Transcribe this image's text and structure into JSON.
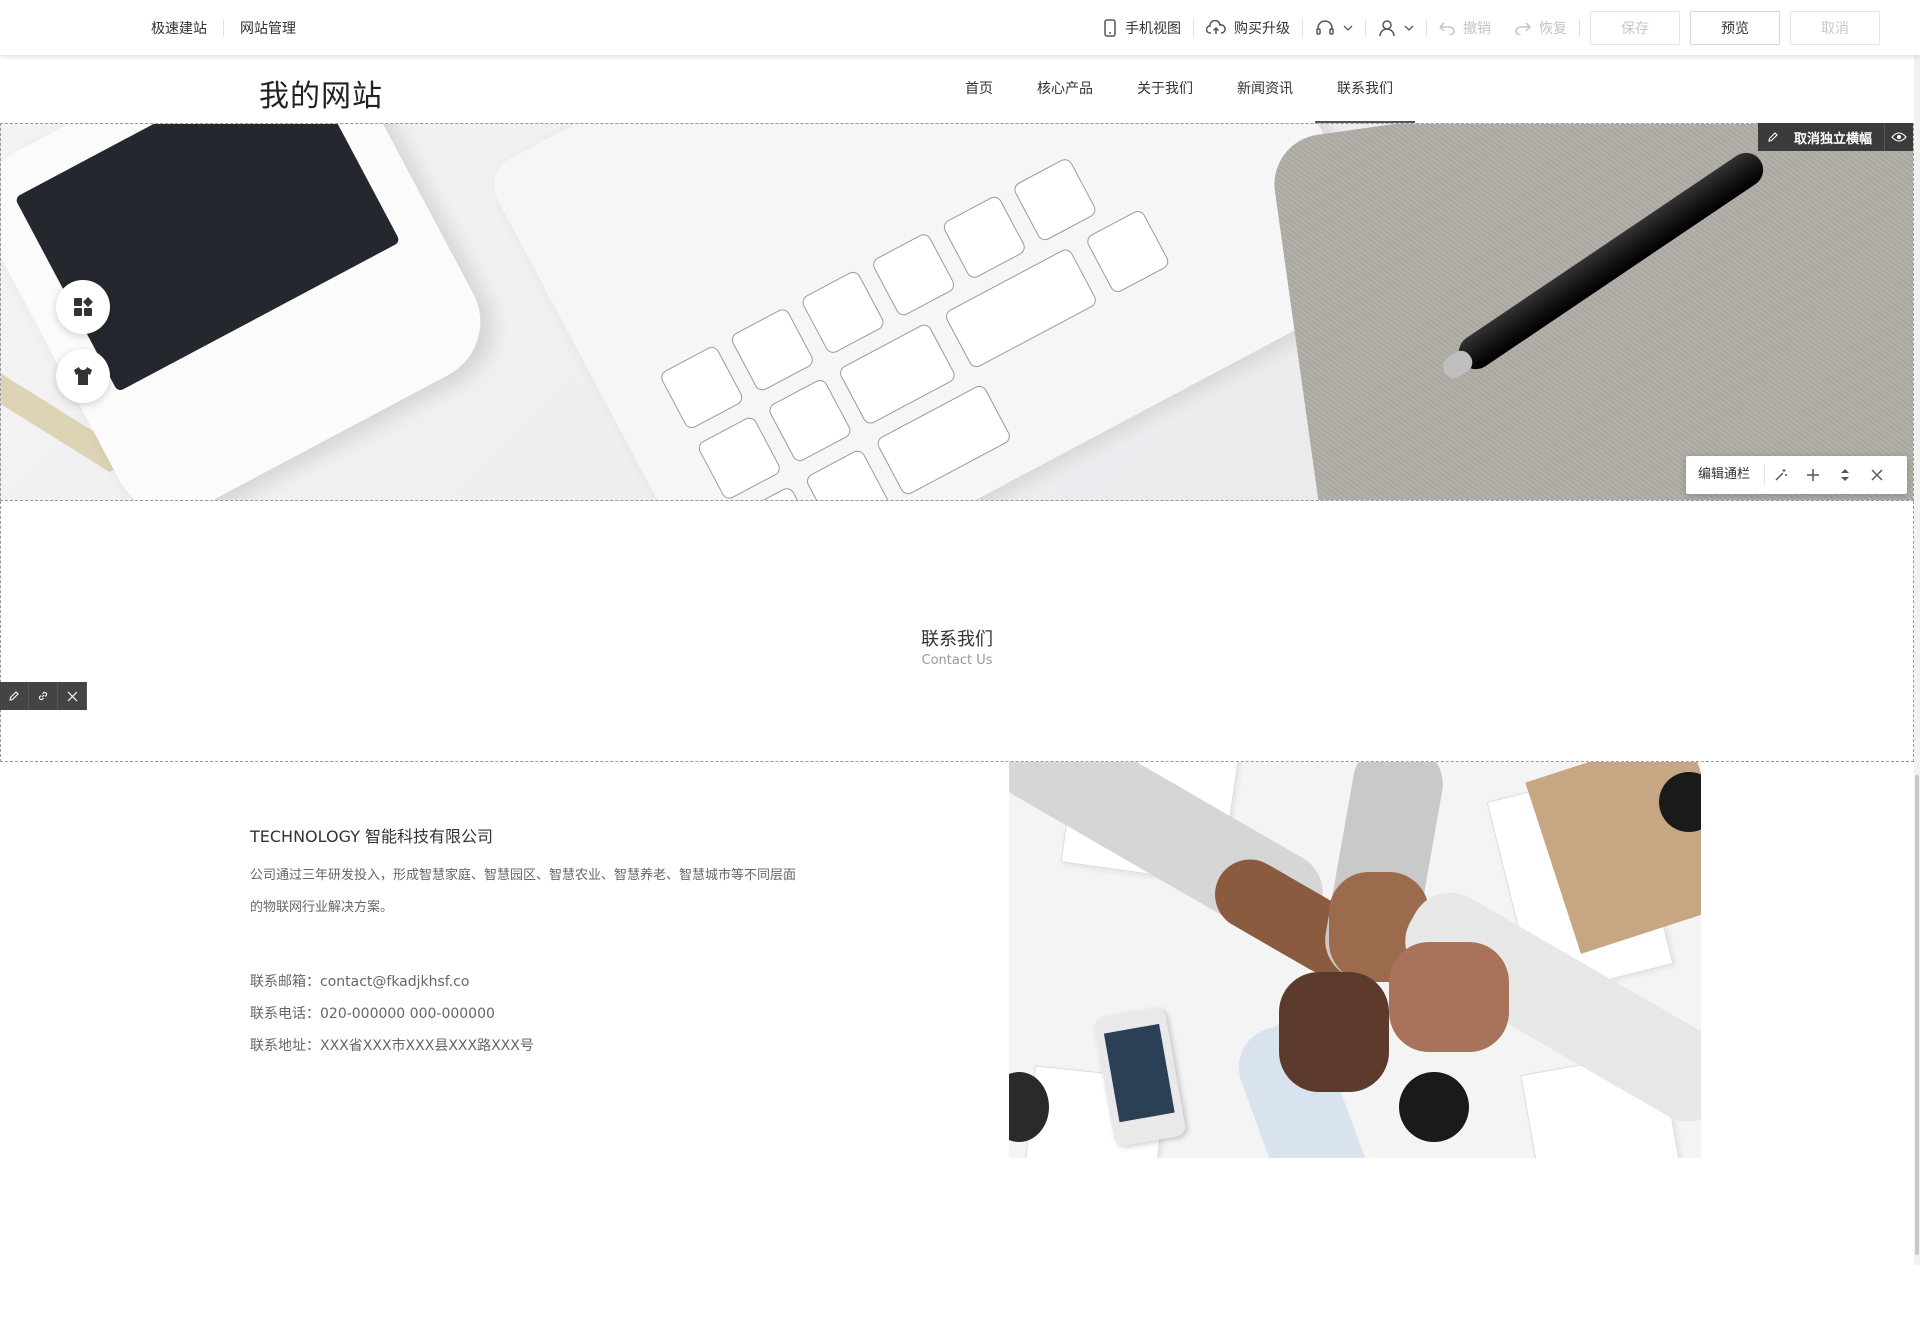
{
  "topbar": {
    "left": [
      "极速建站",
      "网站管理"
    ],
    "mobile_view": "手机视图",
    "upgrade": "购买升级",
    "undo": "撤销",
    "redo": "恢复",
    "save": "保存",
    "preview": "预览",
    "cancel": "取消"
  },
  "site": {
    "logo": "我的网站",
    "nav": [
      "首页",
      "核心产品",
      "关于我们",
      "新闻资讯",
      "联系我们"
    ],
    "active_nav": "联系我们"
  },
  "banner": {
    "cancel_label": "取消独立横幅",
    "edit_channel": "编辑通栏"
  },
  "contact": {
    "title": "联系我们",
    "subtitle": "Contact Us"
  },
  "info": {
    "company": "TECHNOLOGY 智能科技有限公司",
    "desc_line1": "公司通过三年研发投入，形成智慧家庭、智慧园区、智慧农业、智慧养老、智慧城市等不同层面",
    "desc_line2": "的物联网行业解决方案。",
    "email": "联系邮箱：contact@fkadjkhsf.co",
    "phone": "联系电话：020-000000 000-000000",
    "address": "联系地址：XXX省XXX市XXX县XXX路XXX号"
  },
  "colors": {
    "toolbar_dark": "#3b3b3b",
    "text_muted": "#999999"
  }
}
